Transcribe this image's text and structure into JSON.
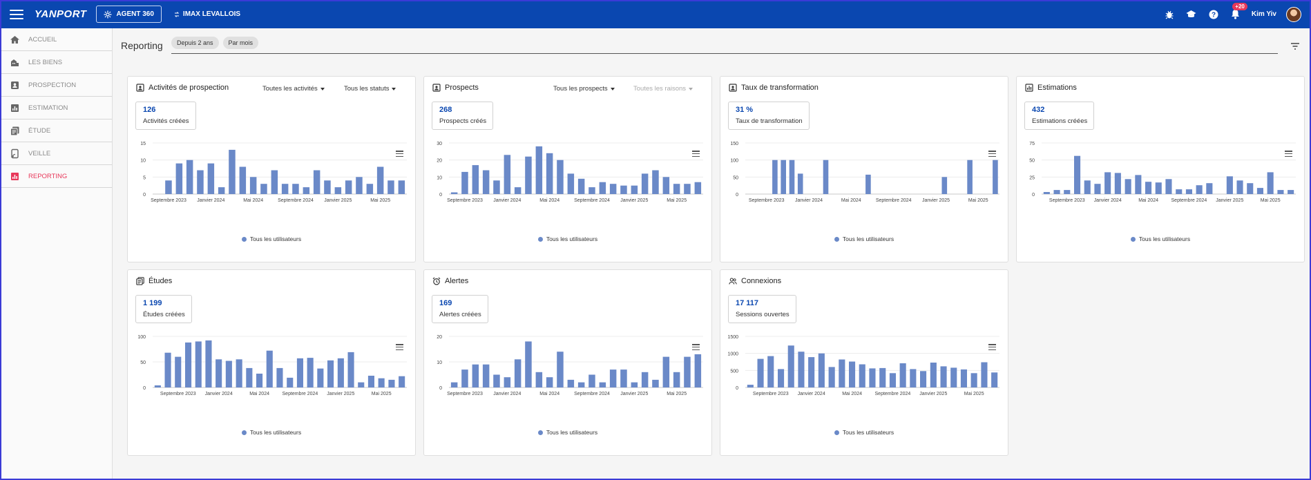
{
  "topbar": {
    "logo": "YANPORT",
    "agent_button": "AGENT 360",
    "agency": "IMAX LEVALLOIS",
    "notif_count": "+20",
    "user_name": "Kim Yiv"
  },
  "sidebar": {
    "items": [
      {
        "label": "ACCUEIL",
        "icon": "home-icon"
      },
      {
        "label": "LES BIENS",
        "icon": "building-icon"
      },
      {
        "label": "PROSPECTION",
        "icon": "contact-icon"
      },
      {
        "label": "ESTIMATION",
        "icon": "chart-icon"
      },
      {
        "label": "ÉTUDE",
        "icon": "document-icon"
      },
      {
        "label": "VEILLE",
        "icon": "watch-icon"
      },
      {
        "label": "REPORTING",
        "icon": "reporting-icon"
      }
    ]
  },
  "header": {
    "title": "Reporting",
    "chips": [
      "Depuis 2 ans",
      "Par mois"
    ]
  },
  "colors": {
    "bar": "#6a89c8",
    "accent": "#0a47b0",
    "active": "#e8385a"
  },
  "cards": [
    {
      "title": "Activités de prospection",
      "icon": "contact-card-icon",
      "dropdowns": [
        "Toutes les activités",
        "Tous les statuts"
      ],
      "dropdown_disabled": [
        false,
        false
      ],
      "kpi_value": "126",
      "kpi_label": "Activités créées",
      "legend": "Tous les utilisateurs"
    },
    {
      "title": "Prospects",
      "icon": "contact-card-icon",
      "dropdowns": [
        "Tous les prospects",
        "Toutes les raisons"
      ],
      "dropdown_disabled": [
        false,
        true
      ],
      "kpi_value": "268",
      "kpi_label": "Prospects créés",
      "legend": "Tous les utilisateurs"
    },
    {
      "title": "Taux de transformation",
      "icon": "contact-card-icon",
      "dropdowns": [],
      "dropdown_disabled": [],
      "kpi_value": "31 %",
      "kpi_label": "Taux de transformation",
      "legend": "Tous les utilisateurs"
    },
    {
      "title": "Estimations",
      "icon": "chart-box-icon",
      "dropdowns": [],
      "dropdown_disabled": [],
      "kpi_value": "432",
      "kpi_label": "Estimations créées",
      "legend": "Tous les utilisateurs"
    },
    {
      "title": "Études",
      "icon": "document-icon",
      "dropdowns": [],
      "dropdown_disabled": [],
      "kpi_value": "1 199",
      "kpi_label": "Études créées",
      "legend": "Tous les utilisateurs"
    },
    {
      "title": "Alertes",
      "icon": "alarm-icon",
      "dropdowns": [],
      "dropdown_disabled": [],
      "kpi_value": "169",
      "kpi_label": "Alertes créées",
      "legend": "Tous les utilisateurs"
    },
    {
      "title": "Connexions",
      "icon": "users-icon",
      "dropdowns": [],
      "dropdown_disabled": [],
      "kpi_value": "17 117",
      "kpi_label": "Sessions ouvertes",
      "legend": "Tous les utilisateurs"
    }
  ],
  "chart_data": [
    {
      "type": "bar",
      "title": "Activités de prospection",
      "series": [
        {
          "name": "Tous les utilisateurs",
          "values": [
            0,
            4,
            9,
            10,
            7,
            9,
            2,
            13,
            8,
            5,
            3,
            7,
            3,
            3,
            2,
            7,
            4,
            2,
            4,
            5,
            3,
            8,
            4,
            4
          ]
        }
      ],
      "ylim": [
        0,
        15
      ],
      "yticks": [
        0,
        5,
        10,
        15
      ],
      "xticks": [
        {
          "index": 1,
          "label": "Septembre 2023"
        },
        {
          "index": 5,
          "label": "Janvier 2024"
        },
        {
          "index": 9,
          "label": "Mai 2024"
        },
        {
          "index": 13,
          "label": "Septembre 2024"
        },
        {
          "index": 17,
          "label": "Janvier 2025"
        },
        {
          "index": 21,
          "label": "Mai 2025"
        }
      ]
    },
    {
      "type": "bar",
      "title": "Prospects",
      "series": [
        {
          "name": "Tous les utilisateurs",
          "values": [
            1,
            13,
            17,
            14,
            8,
            23,
            4,
            22,
            28,
            24,
            20,
            12,
            9,
            4,
            7,
            6,
            5,
            5,
            12,
            14,
            10,
            6,
            6,
            7
          ]
        }
      ],
      "ylim": [
        0,
        30
      ],
      "yticks": [
        0,
        10,
        20,
        30
      ],
      "xticks": [
        {
          "index": 1,
          "label": "Septembre 2023"
        },
        {
          "index": 5,
          "label": "Janvier 2024"
        },
        {
          "index": 9,
          "label": "Mai 2024"
        },
        {
          "index": 13,
          "label": "Septembre 2024"
        },
        {
          "index": 17,
          "label": "Janvier 2025"
        },
        {
          "index": 21,
          "label": "Mai 2025"
        }
      ]
    },
    {
      "type": "bar",
      "title": "Taux de transformation",
      "series": [
        {
          "name": "Tous les utilisateurs",
          "values": [
            0,
            0,
            0,
            100,
            100,
            100,
            60,
            0,
            0,
            100,
            0,
            0,
            0,
            0,
            57,
            0,
            0,
            0,
            0,
            0,
            0,
            0,
            0,
            50,
            0,
            0,
            100,
            0,
            0,
            100
          ]
        }
      ],
      "ylim": [
        0,
        150
      ],
      "yticks": [
        0,
        50,
        100,
        150
      ],
      "xticks": [
        {
          "index": 2,
          "label": "Septembre 2023"
        },
        {
          "index": 7,
          "label": "Janvier 2024"
        },
        {
          "index": 12,
          "label": "Mai 2024"
        },
        {
          "index": 17,
          "label": "Septembre 2024"
        },
        {
          "index": 22,
          "label": "Janvier 2025"
        },
        {
          "index": 27,
          "label": "Mai 2025"
        }
      ]
    },
    {
      "type": "bar",
      "title": "Estimations",
      "series": [
        {
          "name": "Tous les utilisateurs",
          "values": [
            3,
            6,
            6,
            56,
            20,
            15,
            32,
            31,
            22,
            28,
            18,
            17,
            22,
            7,
            7,
            13,
            16,
            0,
            26,
            20,
            16,
            9,
            32,
            6,
            6
          ]
        }
      ],
      "ylim": [
        0,
        75
      ],
      "yticks": [
        0,
        25,
        50,
        75
      ],
      "xticks": [
        {
          "index": 2,
          "label": "Septembre 2023"
        },
        {
          "index": 6,
          "label": "Janvier 2024"
        },
        {
          "index": 10,
          "label": "Mai 2024"
        },
        {
          "index": 14,
          "label": "Septembre 2024"
        },
        {
          "index": 18,
          "label": "Janvier 2025"
        },
        {
          "index": 22,
          "label": "Mai 2025"
        }
      ]
    },
    {
      "type": "bar",
      "title": "Études",
      "series": [
        {
          "name": "Tous les utilisateurs",
          "values": [
            4,
            68,
            60,
            88,
            90,
            92,
            55,
            52,
            55,
            38,
            27,
            72,
            38,
            19,
            57,
            58,
            37,
            53,
            57,
            69,
            10,
            23,
            18,
            15,
            22
          ]
        }
      ],
      "ylim": [
        0,
        100
      ],
      "yticks": [
        0,
        50,
        100
      ],
      "xticks": [
        {
          "index": 2,
          "label": "Septembre 2023"
        },
        {
          "index": 6,
          "label": "Janvier 2024"
        },
        {
          "index": 10,
          "label": "Mai 2024"
        },
        {
          "index": 14,
          "label": "Septembre 2024"
        },
        {
          "index": 18,
          "label": "Janvier 2025"
        },
        {
          "index": 22,
          "label": "Mai 2025"
        }
      ]
    },
    {
      "type": "bar",
      "title": "Alertes",
      "series": [
        {
          "name": "Tous les utilisateurs",
          "values": [
            2,
            7,
            9,
            9,
            5,
            4,
            11,
            18,
            6,
            4,
            14,
            3,
            2,
            5,
            2,
            7,
            7,
            2,
            6,
            3,
            12,
            6,
            12,
            13
          ]
        }
      ],
      "ylim": [
        0,
        20
      ],
      "yticks": [
        0,
        10,
        20
      ],
      "xticks": [
        {
          "index": 1,
          "label": "Septembre 2023"
        },
        {
          "index": 5,
          "label": "Janvier 2024"
        },
        {
          "index": 9,
          "label": "Mai 2024"
        },
        {
          "index": 13,
          "label": "Septembre 2024"
        },
        {
          "index": 17,
          "label": "Janvier 2025"
        },
        {
          "index": 21,
          "label": "Mai 2025"
        }
      ]
    },
    {
      "type": "bar",
      "title": "Connexions",
      "series": [
        {
          "name": "Tous les utilisateurs",
          "values": [
            80,
            840,
            920,
            540,
            1230,
            1050,
            890,
            1000,
            600,
            820,
            760,
            680,
            560,
            570,
            420,
            710,
            540,
            480,
            730,
            620,
            580,
            530,
            420,
            740,
            440
          ]
        }
      ],
      "ylim": [
        0,
        1500
      ],
      "yticks": [
        0,
        500,
        1000,
        1500
      ],
      "xticks": [
        {
          "index": 2,
          "label": "Septembre 2023"
        },
        {
          "index": 6,
          "label": "Janvier 2024"
        },
        {
          "index": 10,
          "label": "Mai 2024"
        },
        {
          "index": 14,
          "label": "Septembre 2024"
        },
        {
          "index": 18,
          "label": "Janvier 2025"
        },
        {
          "index": 22,
          "label": "Mai 2025"
        }
      ]
    }
  ]
}
